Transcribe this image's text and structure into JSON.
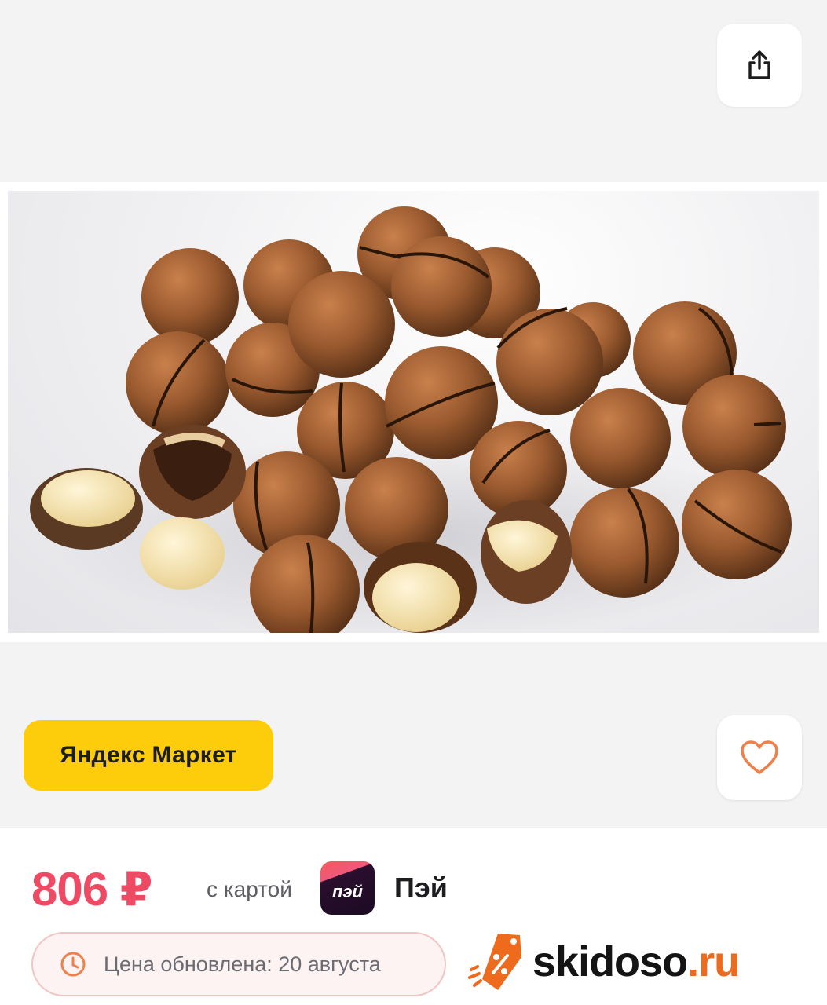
{
  "header": {
    "share_icon": "share-icon"
  },
  "product": {
    "image_alt": "Macadamia nuts in shell",
    "store_label": "Яндекс Маркет",
    "favorite_icon": "heart-icon"
  },
  "pricing": {
    "price": "806 ₽",
    "card_text": "с картой",
    "payment_logo_text": "пэй",
    "payment_name": "Пэй",
    "updated_text": "Цена обновлена: 20 августа"
  },
  "watermark": {
    "brand": "skidoso",
    "tld": ".ru",
    "icon": "discount-tag-icon"
  },
  "colors": {
    "price": "#ee4a63",
    "store_badge": "#fdcc0a",
    "heart": "#f0804a",
    "brand_accent": "#ee6a1c"
  }
}
